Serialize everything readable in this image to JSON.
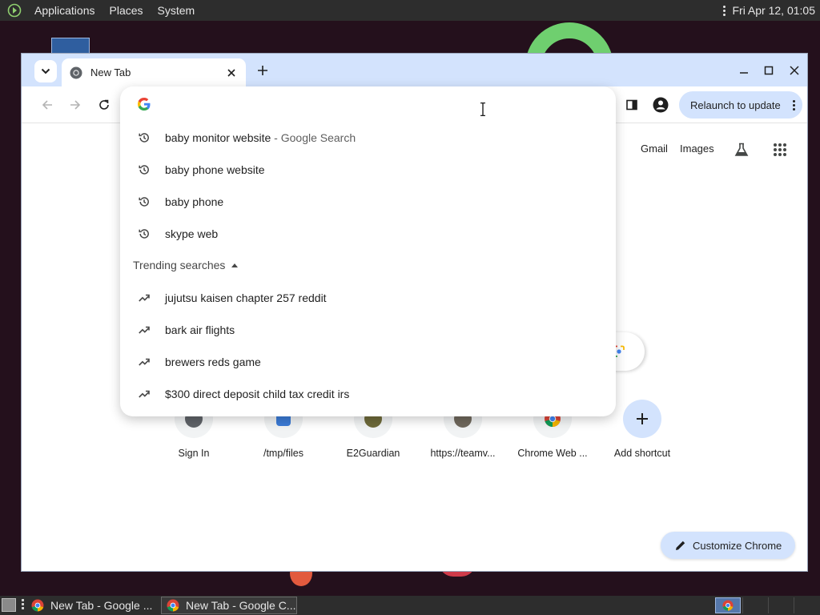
{
  "top_panel": {
    "menus": [
      "Applications",
      "Places",
      "System"
    ],
    "clock": "Fri Apr 12, 01:05"
  },
  "browser": {
    "tab": {
      "title": "New Tab"
    },
    "toolbar": {
      "relaunch_label": "Relaunch to update"
    },
    "ntp": {
      "links": {
        "gmail": "Gmail",
        "images": "Images"
      },
      "shortcuts": [
        {
          "label": "Sign In",
          "icon": "site-icon"
        },
        {
          "label": "/tmp/files",
          "icon": "site-icon"
        },
        {
          "label": "E2Guardian",
          "icon": "site-icon"
        },
        {
          "label": "https://teamv...",
          "icon": "site-icon"
        },
        {
          "label": "Chrome Web ...",
          "icon": "chrome-web-store-icon"
        },
        {
          "label": "Add shortcut",
          "icon": "plus-icon"
        }
      ],
      "customize_label": "Customize Chrome"
    },
    "omnibox": {
      "input_value": "",
      "history": [
        {
          "text": "baby monitor website",
          "suffix": " - Google Search",
          "icon": "history-icon"
        },
        {
          "text": "baby phone website",
          "suffix": "",
          "icon": "history-icon"
        },
        {
          "text": "baby phone",
          "suffix": "",
          "icon": "history-icon"
        },
        {
          "text": "skype web",
          "suffix": "",
          "icon": "history-icon"
        }
      ],
      "trending_header": "Trending searches",
      "trending": [
        {
          "text": "jujutsu kaisen chapter 257 reddit",
          "icon": "trending-icon"
        },
        {
          "text": "bark air flights",
          "icon": "trending-icon"
        },
        {
          "text": "brewers reds game",
          "icon": "trending-icon"
        },
        {
          "text": "$300 direct deposit child tax credit irs",
          "icon": "trending-icon"
        }
      ]
    }
  },
  "taskbar": {
    "tasks": [
      {
        "label": "New Tab - Google ...",
        "active": false
      },
      {
        "label": "New Tab - Google C...",
        "active": true
      }
    ]
  },
  "colors": {
    "accent_blue": "#d3e3fd",
    "desktop_bg": "#24101c",
    "panel_bg": "#2d2d2d"
  }
}
